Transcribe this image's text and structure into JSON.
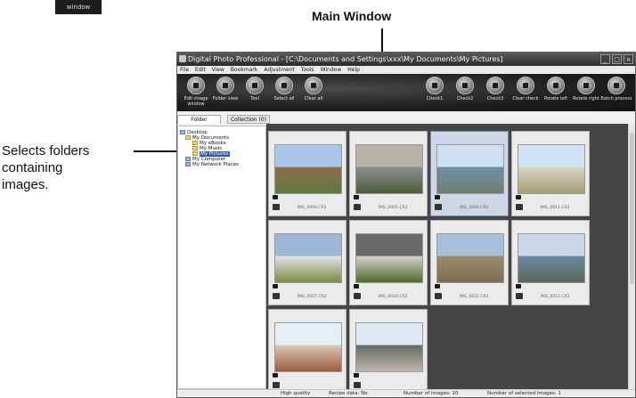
{
  "window_badge": "window",
  "callouts": {
    "main_window": "Main Window",
    "folders_lines": [
      "Selects folders",
      "containing",
      "images."
    ]
  },
  "app": {
    "title": "Digital Photo Professional - [C:\\Documents and Settings\\xxx\\My Documents\\My Pictures]",
    "window_buttons": [
      "_",
      "□",
      "×"
    ],
    "menu": [
      "File",
      "Edit",
      "View",
      "Bookmark",
      "Adjustment",
      "Tools",
      "Window",
      "Help"
    ],
    "toolbar_left": [
      {
        "label": "Edit image window",
        "icon": "edit-image-icon"
      },
      {
        "label": "Folder view",
        "icon": "folder-view-icon"
      },
      {
        "label": "Tool",
        "icon": "tool-icon"
      },
      {
        "label": "Select all",
        "icon": "select-all-icon"
      },
      {
        "label": "Clear all",
        "icon": "clear-all-icon"
      }
    ],
    "toolbar_right": [
      {
        "label": "Check1",
        "icon": "check1-icon"
      },
      {
        "label": "Check2",
        "icon": "check2-icon"
      },
      {
        "label": "Check3",
        "icon": "check3-icon"
      },
      {
        "label": "Clear check",
        "icon": "clear-check-icon"
      },
      {
        "label": "Rotate left",
        "icon": "rotate-left-icon"
      },
      {
        "label": "Rotate right",
        "icon": "rotate-right-icon"
      },
      {
        "label": "Batch process",
        "icon": "batch-process-icon"
      }
    ],
    "tabs": [
      "Folder",
      "Collection (0)"
    ],
    "tree": [
      {
        "label": "Desktop",
        "indent": 0,
        "icon": "desktop-icon"
      },
      {
        "label": "My Documents",
        "indent": 1,
        "icon": "folder-icon"
      },
      {
        "label": "My eBooks",
        "indent": 2,
        "icon": "folder-icon"
      },
      {
        "label": "My Music",
        "indent": 2,
        "icon": "folder-icon"
      },
      {
        "label": "My Pictures",
        "indent": 2,
        "icon": "folder-icon",
        "selected": true
      },
      {
        "label": "My Computer",
        "indent": 1,
        "icon": "computer-icon"
      },
      {
        "label": "My Network Places",
        "indent": 1,
        "icon": "network-icon"
      }
    ],
    "thumbnails": [
      {
        "file": "IMG_0000.CR2",
        "selected": false,
        "colors": [
          "#aac6e8",
          "#5f7a3c",
          "#8f6d4c"
        ]
      },
      {
        "file": "IMG_0001.CR2",
        "selected": false,
        "colors": [
          "#b9b2a7",
          "#4f5b3a",
          "#8c8f93"
        ]
      },
      {
        "file": "IMG_0002.CR2",
        "selected": true,
        "colors": [
          "#cfe0f0",
          "#6f7f6b",
          "#6e8fa6"
        ]
      },
      {
        "file": "IMG_0011.CR2",
        "selected": false,
        "colors": [
          "#cfe3f4",
          "#a4a074",
          "#d9d2c4"
        ]
      },
      {
        "file": "IMG_0017.CR2",
        "selected": false,
        "colors": [
          "#9eb7d8",
          "#7b8b45",
          "#e2e2e2"
        ]
      },
      {
        "file": "IMG_0018.CR2",
        "selected": false,
        "colors": [
          "#6a6a6a",
          "#4f6a2d",
          "#d8d2c8"
        ]
      },
      {
        "file": "IMG_0022.CR2",
        "selected": false,
        "colors": [
          "#a8bfd9",
          "#7c6d53",
          "#9e8a6a"
        ]
      },
      {
        "file": "IMG_0023.CR2",
        "selected": false,
        "colors": [
          "#c9d7e6",
          "#5b6a57",
          "#6d86a3"
        ]
      },
      {
        "file": "",
        "selected": false,
        "colors": [
          "#e6eef6",
          "#9b5d3c",
          "#d8c7b7"
        ]
      },
      {
        "file": "",
        "selected": false,
        "colors": [
          "#dfe8f3",
          "#bfb7aa",
          "#606a63"
        ]
      }
    ],
    "status": {
      "quality": "High quality",
      "recipe": "Recipe data: No",
      "images": "Number of images: 10",
      "selected_images": "Number of selected images: 1"
    }
  }
}
